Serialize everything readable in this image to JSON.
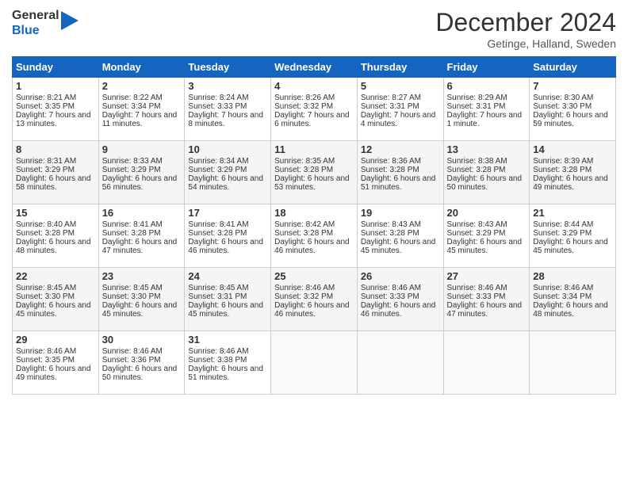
{
  "logo": {
    "line1": "General",
    "line2": "Blue"
  },
  "title": "December 2024",
  "subtitle": "Getinge, Halland, Sweden",
  "days_of_week": [
    "Sunday",
    "Monday",
    "Tuesday",
    "Wednesday",
    "Thursday",
    "Friday",
    "Saturday"
  ],
  "weeks": [
    [
      {
        "day": 1,
        "sunrise": "8:21 AM",
        "sunset": "3:35 PM",
        "daylight": "7 hours and 13 minutes."
      },
      {
        "day": 2,
        "sunrise": "8:22 AM",
        "sunset": "3:34 PM",
        "daylight": "7 hours and 11 minutes."
      },
      {
        "day": 3,
        "sunrise": "8:24 AM",
        "sunset": "3:33 PM",
        "daylight": "7 hours and 8 minutes."
      },
      {
        "day": 4,
        "sunrise": "8:26 AM",
        "sunset": "3:32 PM",
        "daylight": "7 hours and 6 minutes."
      },
      {
        "day": 5,
        "sunrise": "8:27 AM",
        "sunset": "3:31 PM",
        "daylight": "7 hours and 4 minutes."
      },
      {
        "day": 6,
        "sunrise": "8:29 AM",
        "sunset": "3:31 PM",
        "daylight": "7 hours and 1 minute."
      },
      {
        "day": 7,
        "sunrise": "8:30 AM",
        "sunset": "3:30 PM",
        "daylight": "6 hours and 59 minutes."
      }
    ],
    [
      {
        "day": 8,
        "sunrise": "8:31 AM",
        "sunset": "3:29 PM",
        "daylight": "6 hours and 58 minutes."
      },
      {
        "day": 9,
        "sunrise": "8:33 AM",
        "sunset": "3:29 PM",
        "daylight": "6 hours and 56 minutes."
      },
      {
        "day": 10,
        "sunrise": "8:34 AM",
        "sunset": "3:29 PM",
        "daylight": "6 hours and 54 minutes."
      },
      {
        "day": 11,
        "sunrise": "8:35 AM",
        "sunset": "3:28 PM",
        "daylight": "6 hours and 53 minutes."
      },
      {
        "day": 12,
        "sunrise": "8:36 AM",
        "sunset": "3:28 PM",
        "daylight": "6 hours and 51 minutes."
      },
      {
        "day": 13,
        "sunrise": "8:38 AM",
        "sunset": "3:28 PM",
        "daylight": "6 hours and 50 minutes."
      },
      {
        "day": 14,
        "sunrise": "8:39 AM",
        "sunset": "3:28 PM",
        "daylight": "6 hours and 49 minutes."
      }
    ],
    [
      {
        "day": 15,
        "sunrise": "8:40 AM",
        "sunset": "3:28 PM",
        "daylight": "6 hours and 48 minutes."
      },
      {
        "day": 16,
        "sunrise": "8:41 AM",
        "sunset": "3:28 PM",
        "daylight": "6 hours and 47 minutes."
      },
      {
        "day": 17,
        "sunrise": "8:41 AM",
        "sunset": "3:28 PM",
        "daylight": "6 hours and 46 minutes."
      },
      {
        "day": 18,
        "sunrise": "8:42 AM",
        "sunset": "3:28 PM",
        "daylight": "6 hours and 46 minutes."
      },
      {
        "day": 19,
        "sunrise": "8:43 AM",
        "sunset": "3:28 PM",
        "daylight": "6 hours and 45 minutes."
      },
      {
        "day": 20,
        "sunrise": "8:43 AM",
        "sunset": "3:29 PM",
        "daylight": "6 hours and 45 minutes."
      },
      {
        "day": 21,
        "sunrise": "8:44 AM",
        "sunset": "3:29 PM",
        "daylight": "6 hours and 45 minutes."
      }
    ],
    [
      {
        "day": 22,
        "sunrise": "8:45 AM",
        "sunset": "3:30 PM",
        "daylight": "6 hours and 45 minutes."
      },
      {
        "day": 23,
        "sunrise": "8:45 AM",
        "sunset": "3:30 PM",
        "daylight": "6 hours and 45 minutes."
      },
      {
        "day": 24,
        "sunrise": "8:45 AM",
        "sunset": "3:31 PM",
        "daylight": "6 hours and 45 minutes."
      },
      {
        "day": 25,
        "sunrise": "8:46 AM",
        "sunset": "3:32 PM",
        "daylight": "6 hours and 46 minutes."
      },
      {
        "day": 26,
        "sunrise": "8:46 AM",
        "sunset": "3:33 PM",
        "daylight": "6 hours and 46 minutes."
      },
      {
        "day": 27,
        "sunrise": "8:46 AM",
        "sunset": "3:33 PM",
        "daylight": "6 hours and 47 minutes."
      },
      {
        "day": 28,
        "sunrise": "8:46 AM",
        "sunset": "3:34 PM",
        "daylight": "6 hours and 48 minutes."
      }
    ],
    [
      {
        "day": 29,
        "sunrise": "8:46 AM",
        "sunset": "3:35 PM",
        "daylight": "6 hours and 49 minutes."
      },
      {
        "day": 30,
        "sunrise": "8:46 AM",
        "sunset": "3:36 PM",
        "daylight": "6 hours and 50 minutes."
      },
      {
        "day": 31,
        "sunrise": "8:46 AM",
        "sunset": "3:38 PM",
        "daylight": "6 hours and 51 minutes."
      },
      null,
      null,
      null,
      null
    ]
  ]
}
